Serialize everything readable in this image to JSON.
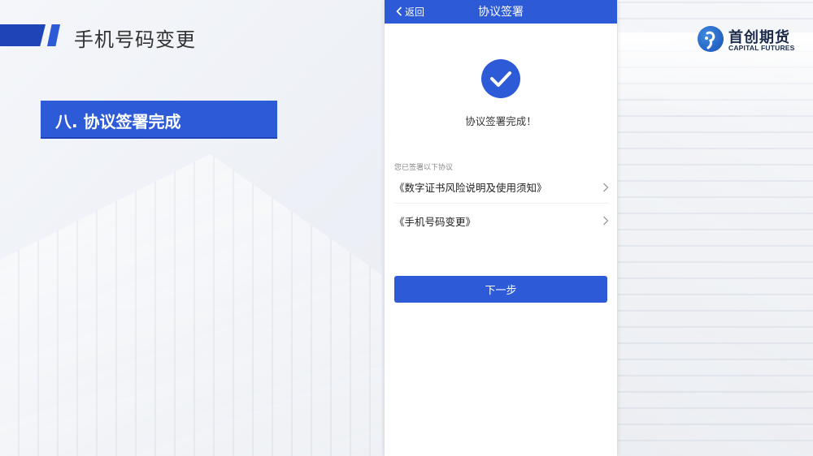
{
  "slide": {
    "title": "手机号码变更",
    "step_heading": "八. 协议签署完成"
  },
  "logo": {
    "name_cn": "首创期货",
    "name_en": "CAPITAL FUTURES"
  },
  "phone": {
    "header": {
      "back_label": "返回",
      "title": "协议签署"
    },
    "success_message": "协议签署完成！",
    "signed_caption": "您已签署以下协议",
    "agreements": [
      {
        "label": "《数字证书风险说明及使用须知》"
      },
      {
        "label": "《手机号码变更》"
      }
    ],
    "next_button_label": "下一步"
  },
  "colors": {
    "primary": "#2d5ad6",
    "accent_dark": "#1e44b8"
  }
}
